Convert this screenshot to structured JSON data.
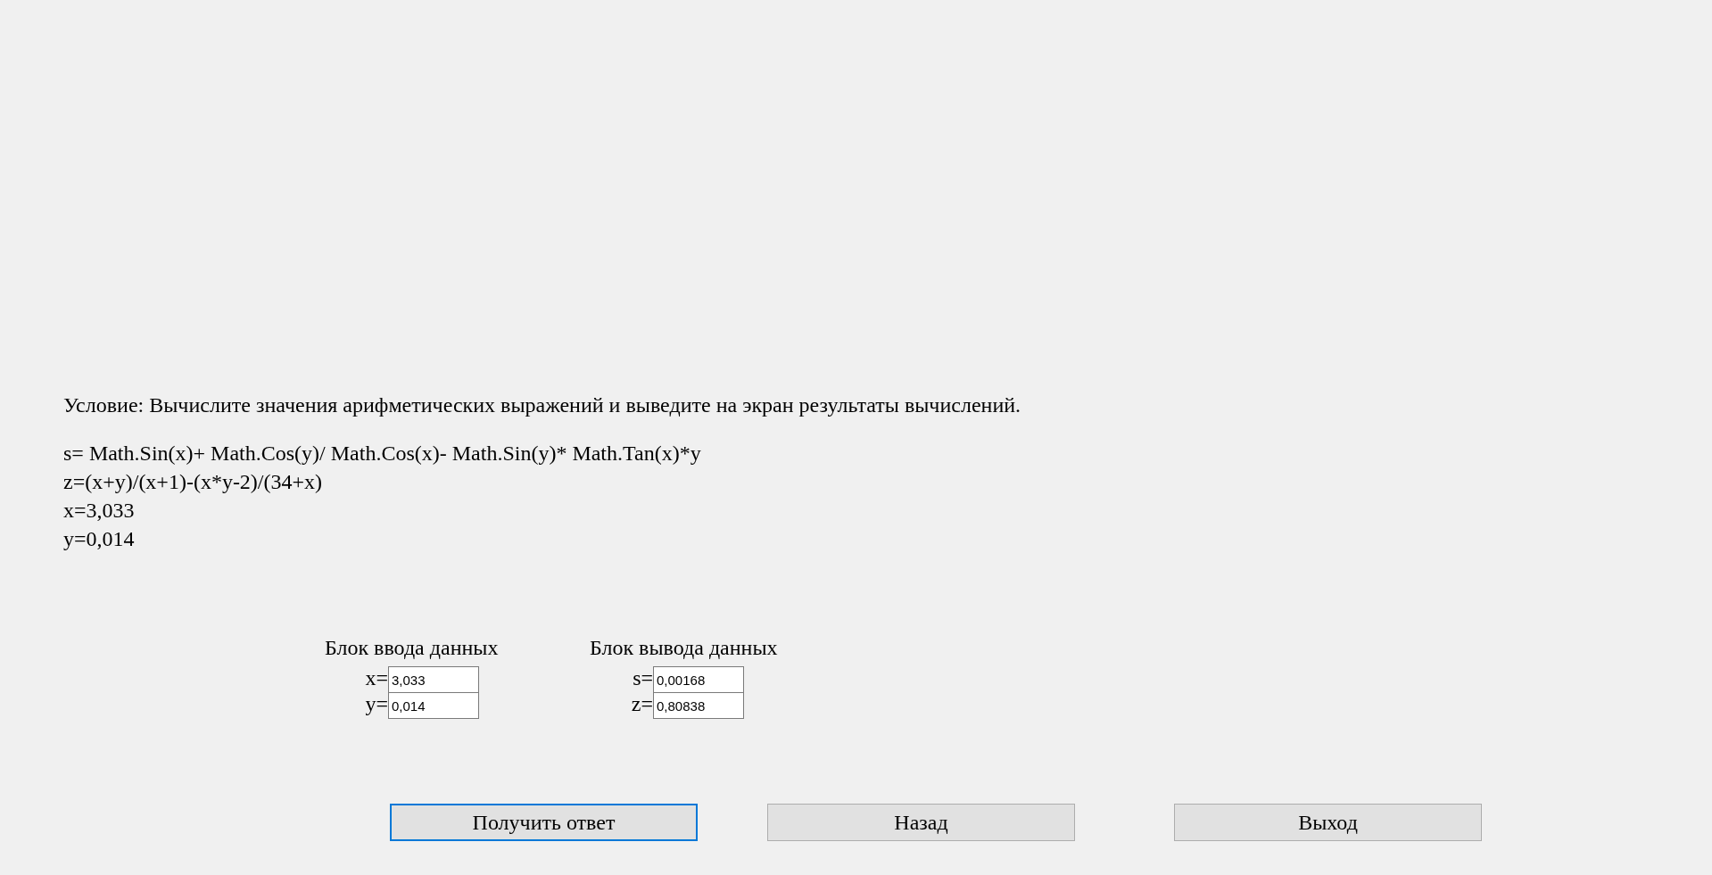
{
  "condition": "Условие: Вычислите значения арифметических выражений и выведите на экран результаты вычислений.",
  "formulas": [
    "s= Math.Sin(x)+ Math.Cos(y)/ Math.Cos(x)- Math.Sin(y)* Math.Tan(x)*y",
    "z=(x+y)/(x+1)-(x*y-2)/(34+x)",
    "x=3,033",
    "y=0,014"
  ],
  "blocks": [
    {
      "title": "Блок ввода данных",
      "fields": [
        {
          "label": "x=",
          "value": "3,033"
        },
        {
          "label": "y=",
          "value": "0,014"
        }
      ]
    },
    {
      "title": "Блок вывода данных",
      "fields": [
        {
          "label": "s=",
          "value": "0,00168"
        },
        {
          "label": "z=",
          "value": "0,80838"
        }
      ]
    }
  ],
  "buttons": [
    {
      "label": "Получить ответ",
      "focused": true
    },
    {
      "label": "Назад",
      "focused": false
    },
    {
      "label": "Выход",
      "focused": false
    }
  ]
}
